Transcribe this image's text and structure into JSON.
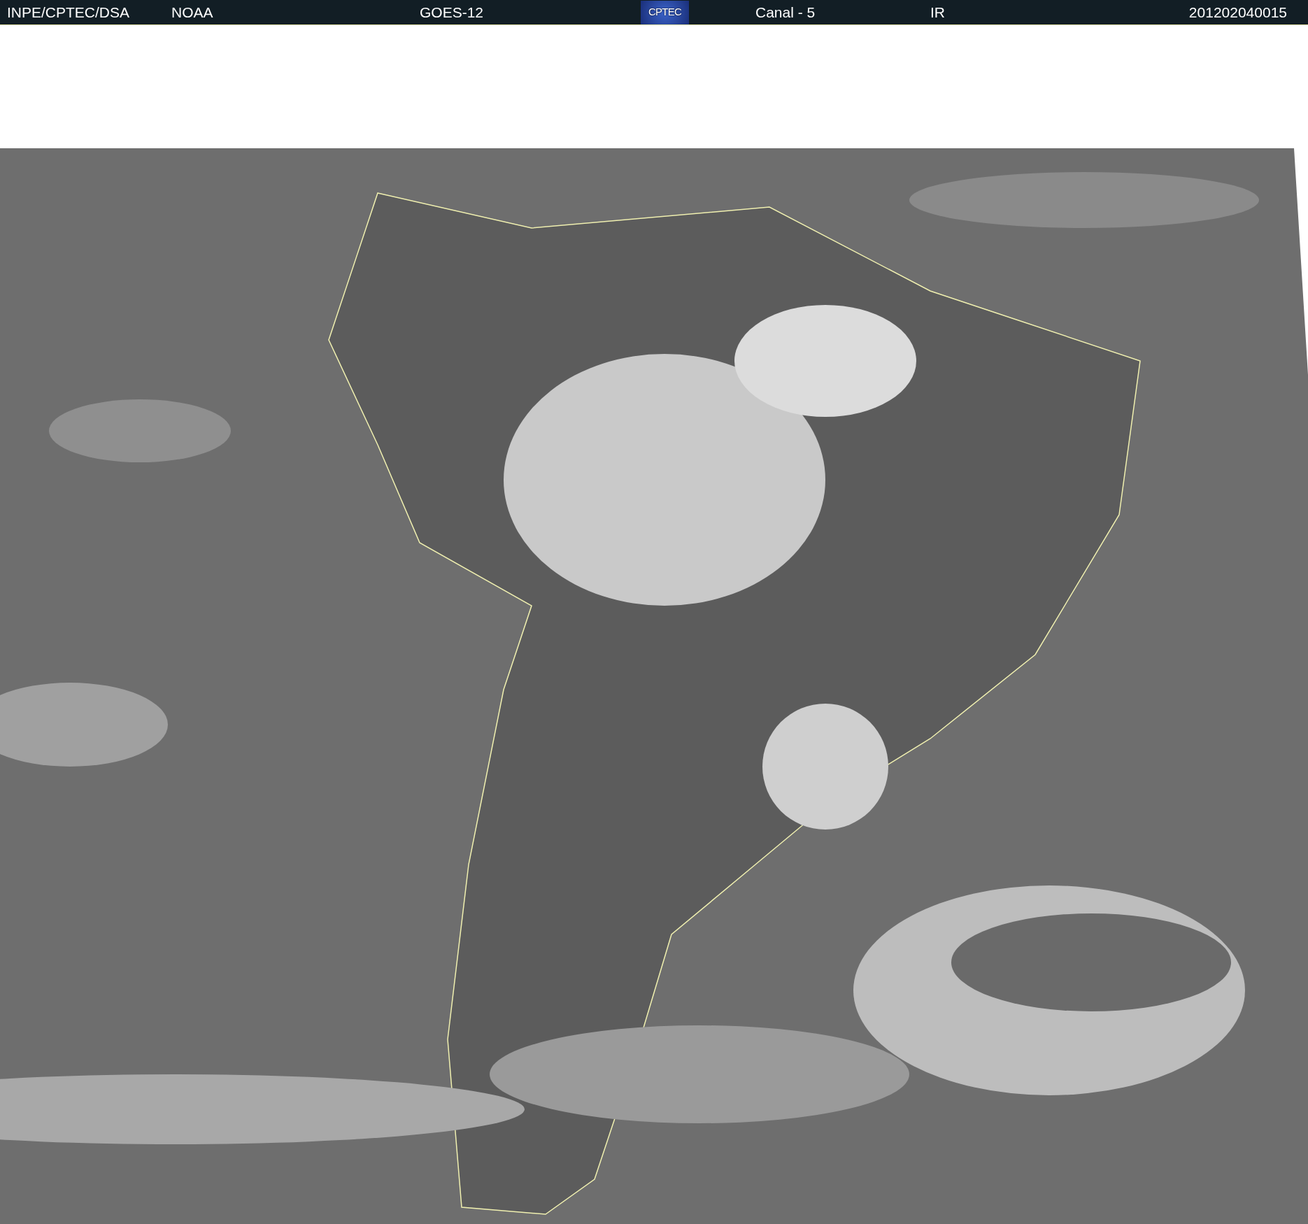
{
  "header": {
    "source": "INPE/CPTEC/DSA",
    "agency": "NOAA",
    "satellite": "GOES-12",
    "logo_text": "CPTEC",
    "channel": "Canal - 5",
    "band": "IR",
    "timestamp": "201202040015"
  }
}
